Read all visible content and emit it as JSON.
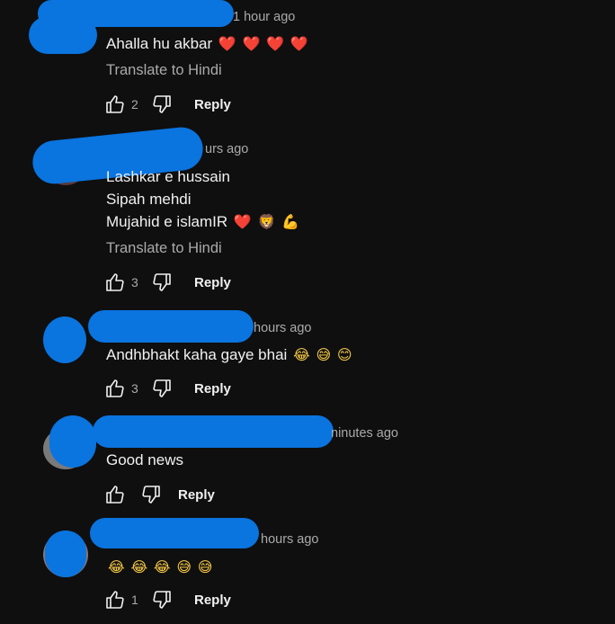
{
  "comments": [
    {
      "timestamp": "1 hour ago",
      "lines": [
        "Ahalla hu akbar"
      ],
      "emoji": [
        "❤️",
        "❤️",
        "❤️",
        "❤️"
      ],
      "translate": "Translate to Hindi",
      "likes": "2",
      "reply": "Reply"
    },
    {
      "timestamp": "urs ago",
      "lines": [
        "Lashkar e hussain",
        "Sipah mehdi",
        "Mujahid e islamIR"
      ],
      "emoji": [
        "❤️",
        "🦁",
        "💪"
      ],
      "translate": "Translate to Hindi",
      "likes": "3",
      "reply": "Reply"
    },
    {
      "timestamp": "hours ago",
      "lines": [
        "Andhbhakt kaha gaye bhai"
      ],
      "emoji": [
        "😂",
        "😅",
        "😊"
      ],
      "likes": "3",
      "reply": "Reply"
    },
    {
      "timestamp": "ninutes ago",
      "lines": [
        "Good news"
      ],
      "emoji": [],
      "likes": "",
      "reply": "Reply"
    },
    {
      "timestamp": "hours ago",
      "lines": [
        ""
      ],
      "emoji": [
        "😂",
        "😂",
        "😂",
        "😅",
        "😅"
      ],
      "likes": "1",
      "reply": "Reply"
    }
  ],
  "icons": {
    "like": "thumbs-up-icon",
    "dislike": "thumbs-down-icon"
  },
  "colors": {
    "background": "#0f0f0f",
    "redaction": "#0a74df",
    "secondary_text": "#aaaaaa"
  }
}
